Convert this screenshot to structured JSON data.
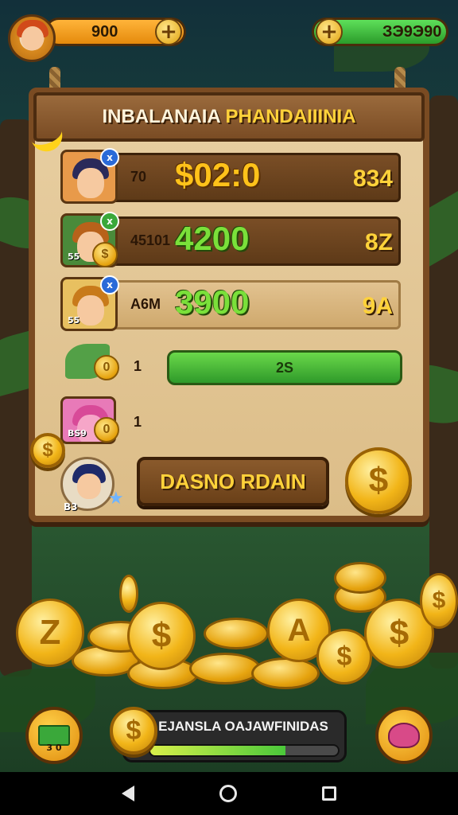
{
  "top_bar": {
    "left_value": "900",
    "right_value": "ЗЭ9Э90",
    "plus_label": "+"
  },
  "board": {
    "title_part1": "INBALANAIA",
    "title_part2": "PHANDAIIINIA"
  },
  "rows": [
    {
      "badge": "x",
      "rank": "70",
      "score": "$02:0",
      "right": "834",
      "level": ""
    },
    {
      "badge": "x",
      "rank": "45101",
      "score": "4200",
      "right": "8Z",
      "level": "55"
    },
    {
      "badge": "x",
      "rank": "A6M",
      "score": "3900",
      "right": "9A",
      "level": "55"
    }
  ],
  "simple_rows": [
    {
      "number": "1",
      "bar_text": "2S"
    },
    {
      "number": "1",
      "level": "BS9"
    }
  ],
  "action_button": {
    "label": "DASNO RDAIN"
  },
  "mascot_level": "B3",
  "bottom_hud": {
    "progress_label": "EJANSLA OAJAWFINIDAS",
    "progress_fraction": 0.72,
    "left_button_value": "3 0"
  },
  "colors": {
    "wood_dark": "#7a4b22",
    "board_light": "#e8cfa2",
    "gold": "#ffc21a",
    "green": "#7ae03a"
  }
}
